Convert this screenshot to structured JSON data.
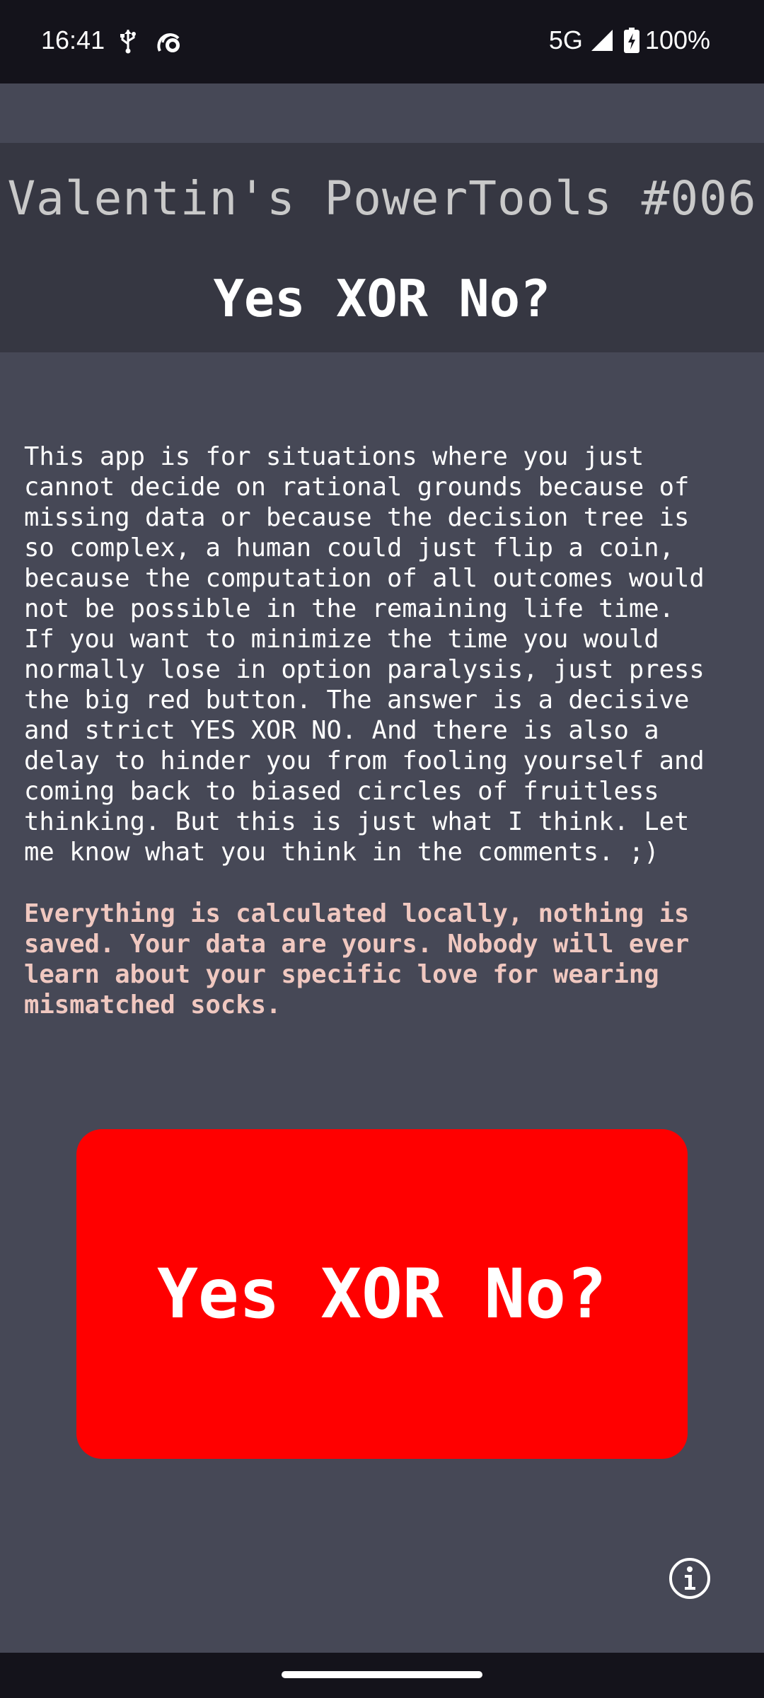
{
  "status_bar": {
    "time": "16:41",
    "network": "5G",
    "battery": "100%",
    "icons": [
      "usb-icon",
      "satellite-icon",
      "signal-icon",
      "battery-charging-icon"
    ]
  },
  "header": {
    "title": "Valentin's PowerTools #006",
    "subtitle": "Yes XOR No?"
  },
  "main": {
    "description": "This app is for situations where you just\ncannot decide on rational grounds because of\nmissing data or because the decision tree is\nso complex, a human could just flip a coin,\nbecause the computation of all outcomes would\nnot be possible in the remaining life time.\nIf you want to minimize the time you would\nnormally lose in option paralysis, just press\nthe big red button. The answer is a decisive\nand strict YES XOR NO. And there is also a\ndelay to hinder you from fooling yourself and\ncoming back to biased circles of fruitless\nthinking. But this is just what I think. Let\nme know what you think in the comments. ;)",
    "privacy_note": "Everything is calculated locally, nothing is\nsaved. Your data are yours. Nobody will ever\nlearn about your specific love for wearing\nmismatched socks.",
    "button_label": "Yes XOR No?"
  },
  "colors": {
    "background": "#464856",
    "header": "#363742",
    "button": "#ff0000",
    "privacy_text": "#f0c8c0"
  }
}
